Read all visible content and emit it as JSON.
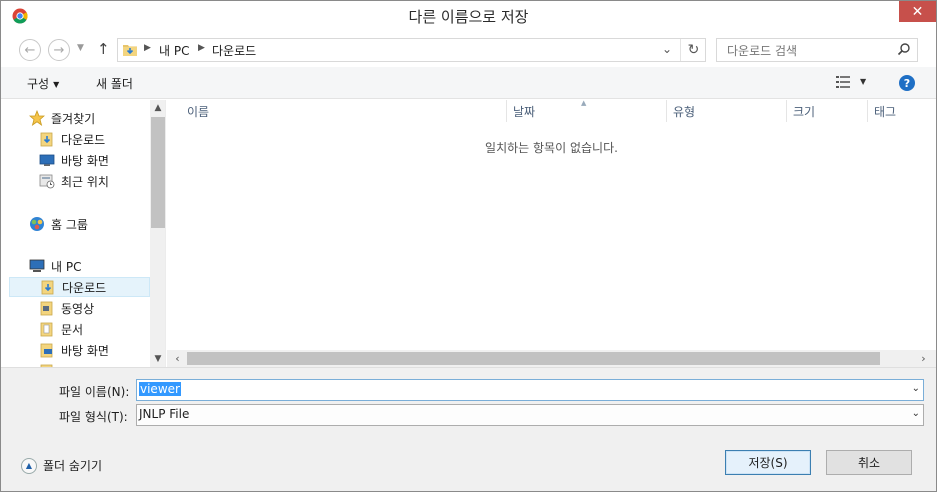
{
  "window": {
    "title": "다른 이름으로 저장",
    "close_glyph": "✕"
  },
  "address": {
    "segments": [
      "내 PC",
      "다운로드"
    ],
    "search_placeholder": "다운로드 검색"
  },
  "toolbar": {
    "organize_label": "구성",
    "new_folder_label": "새 폴더"
  },
  "nav_pane": {
    "items": [
      {
        "label": "즐겨찾기",
        "icon": "star-icon"
      },
      {
        "label": "다운로드",
        "icon": "downloads-folder-icon"
      },
      {
        "label": "바탕 화면",
        "icon": "desktop-icon"
      },
      {
        "label": "최근 위치",
        "icon": "recent-places-icon"
      },
      {
        "label": "홈 그룹",
        "icon": "homegroup-icon"
      },
      {
        "label": "내 PC",
        "icon": "computer-icon"
      },
      {
        "label": "다운로드",
        "icon": "downloads-folder-icon"
      },
      {
        "label": "동영상",
        "icon": "videos-folder-icon"
      },
      {
        "label": "문서",
        "icon": "documents-folder-icon"
      },
      {
        "label": "바탕 화면",
        "icon": "desktop-folder-icon"
      }
    ]
  },
  "file_list": {
    "columns": [
      "이름",
      "날짜",
      "유형",
      "크기",
      "태그"
    ],
    "empty_message": "일치하는 항목이 없습니다."
  },
  "form": {
    "file_name_label": "파일 이름(N):",
    "file_name_value": "viewer",
    "file_type_label": "파일 형식(T):",
    "file_type_value": "JNLP File"
  },
  "footer": {
    "hide_folders_label": "폴더 숨기기",
    "save_label": "저장(S)",
    "cancel_label": "취소"
  },
  "colors": {
    "close_button": "#c7504b",
    "selection": "#3399ff",
    "help_icon": "#1f6fc5"
  }
}
